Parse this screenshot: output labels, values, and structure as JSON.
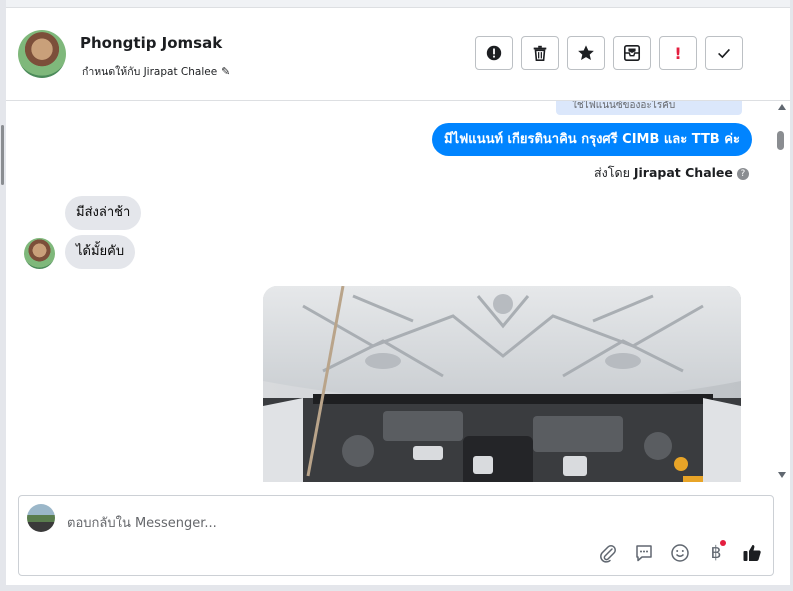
{
  "header": {
    "contact_name": "Phongtip Jomsak",
    "assigned_label": "กำหนดให้กับ Jirapat Chalee",
    "tools": [
      {
        "name": "mark-spam-button",
        "icon": "alert-circle-icon"
      },
      {
        "name": "delete-button",
        "icon": "trash-icon"
      },
      {
        "name": "star-button",
        "icon": "star-icon"
      },
      {
        "name": "move-to-inbox-button",
        "icon": "inbox-icon"
      },
      {
        "name": "mark-follow-up-button",
        "icon": "exclamation-icon"
      },
      {
        "name": "mark-done-button",
        "icon": "check-icon"
      }
    ]
  },
  "thread": {
    "previous_snippet": "ใช่ไฟแนนซ์ของอะไรคับ",
    "outgoing_message": "มีไฟแนนท์  เกียรตินาคิน กรุงศรี CIMB และ TTB ค่ะ",
    "sent_by_prefix": "ส่งโดย",
    "sent_by_name": "Jirapat Chalee",
    "help_glyph": "?",
    "incoming_messages": [
      "มีส่งล่าช้า",
      "ได้มั้ยคับ"
    ],
    "photo_subject": "car-engine-bay-photo"
  },
  "composer": {
    "placeholder": "ตอบกลับใน Messenger...",
    "currency_glyph": "฿"
  },
  "colors": {
    "accent": "#0084ff",
    "incoming_bubble": "#e4e6eb",
    "alert": "#e41e3f"
  }
}
